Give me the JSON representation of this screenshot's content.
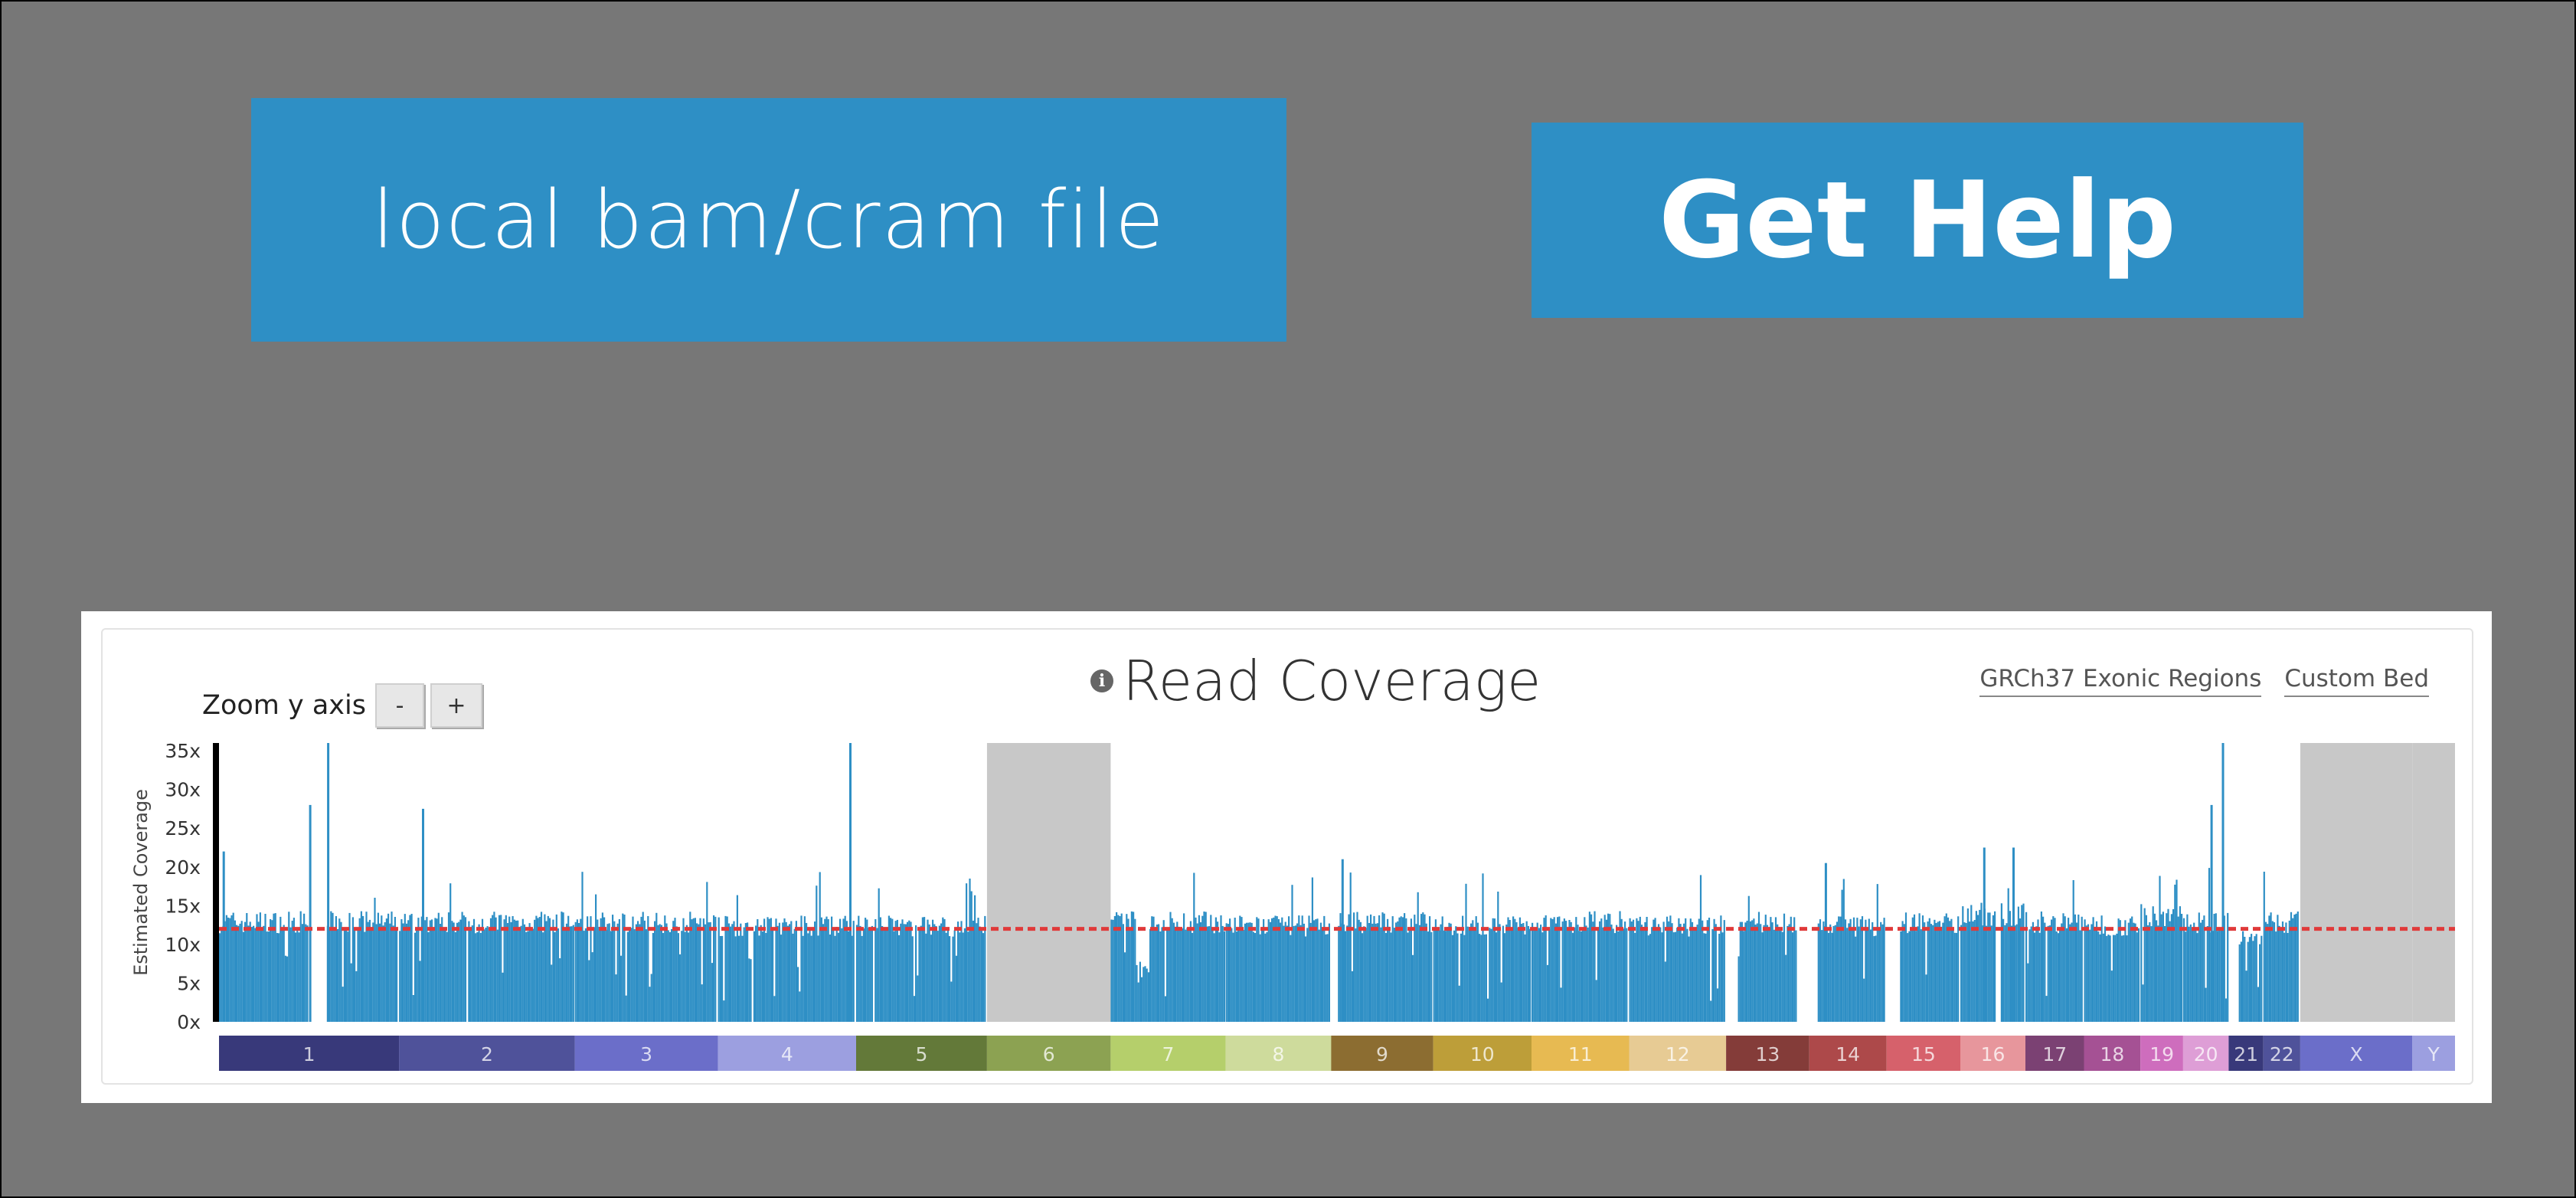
{
  "buttons": {
    "local_file": "local bam/cram file",
    "get_help": "Get Help"
  },
  "coverage": {
    "title": "Read Coverage",
    "info_icon": "info-icon",
    "zoom_label": "Zoom y axis",
    "zoom_minus": "-",
    "zoom_plus": "+",
    "link_exonic": "GRCh37 Exonic Regions",
    "link_custom": "Custom Bed"
  },
  "colors": {
    "button_bg": "#2e8fc5",
    "bar": "#2e8fc5",
    "median_line": "#e03a3a",
    "excluded": "#c8c8c8"
  },
  "chart_data": {
    "type": "bar",
    "ylabel": "Estimated Coverage",
    "yticks": [
      "0x",
      "5x",
      "10x",
      "15x",
      "20x",
      "25x",
      "30x",
      "35x"
    ],
    "ylim": [
      0,
      36
    ],
    "median_coverage": 12,
    "chromosomes": [
      {
        "name": "1",
        "len": 249,
        "color": "#38397a",
        "baseline": 13,
        "spikes": [
          [
            0.02,
            22
          ],
          [
            0.5,
            28
          ],
          [
            0.6,
            36
          ]
        ],
        "gaps": [
          [
            0.5,
            0.6
          ]
        ]
      },
      {
        "name": "2",
        "len": 243,
        "color": "#4f529a",
        "baseline": 13,
        "spikes": [
          [
            0.13,
            27.5
          ]
        ],
        "gaps": [
          [
            0.38,
            0.39
          ]
        ]
      },
      {
        "name": "3",
        "len": 198,
        "color": "#6b6ec9",
        "baseline": 13,
        "spikes": [],
        "gaps": [
          [
            0.81,
            0.82
          ]
        ]
      },
      {
        "name": "4",
        "len": 191,
        "color": "#9c9fe0",
        "baseline": 12.5,
        "spikes": [
          [
            0.95,
            36
          ]
        ],
        "gaps": [
          [
            0.24,
            0.25
          ]
        ]
      },
      {
        "name": "5",
        "len": 181,
        "color": "#637939",
        "baseline": 12.5,
        "spikes": [],
        "gaps": [
          [
            0.12,
            0.13
          ]
        ]
      },
      {
        "name": "6",
        "len": 171,
        "color": "#8ca252",
        "baseline": 0,
        "excluded": true,
        "spikes": [],
        "gaps": []
      },
      {
        "name": "7",
        "len": 159,
        "color": "#b5cf6b",
        "baseline": 13,
        "spikes": [],
        "gaps": [],
        "dips": [
          [
            0.22,
            0.33,
            7
          ]
        ]
      },
      {
        "name": "8",
        "len": 146,
        "color": "#cedb9c",
        "baseline": 12.5,
        "spikes": [],
        "gaps": []
      },
      {
        "name": "9",
        "len": 141,
        "color": "#8c6d31",
        "baseline": 13,
        "spikes": [
          [
            0.1,
            21
          ]
        ],
        "gaps": [
          [
            0.0,
            0.06
          ]
        ]
      },
      {
        "name": "10",
        "len": 136,
        "color": "#bd9e39",
        "baseline": 12.5,
        "spikes": [],
        "gaps": []
      },
      {
        "name": "11",
        "len": 135,
        "color": "#e7ba52",
        "baseline": 13,
        "spikes": [],
        "gaps": []
      },
      {
        "name": "12",
        "len": 134,
        "color": "#e7cb94",
        "baseline": 12.5,
        "spikes": [],
        "gaps": []
      },
      {
        "name": "13",
        "len": 115,
        "color": "#843c39",
        "baseline": 13,
        "spikes": [],
        "gaps": [
          [
            0.0,
            0.14
          ],
          [
            0.85,
            1.0
          ]
        ]
      },
      {
        "name": "14",
        "len": 107,
        "color": "#ad494a",
        "baseline": 12.5,
        "spikes": [
          [
            0.2,
            20.5
          ]
        ],
        "gaps": [
          [
            0.0,
            0.1
          ]
        ]
      },
      {
        "name": "15",
        "len": 102,
        "color": "#d6616b",
        "baseline": 13,
        "spikes": [],
        "gaps": [
          [
            0.0,
            0.17
          ]
        ]
      },
      {
        "name": "16",
        "len": 90,
        "color": "#e7969c",
        "baseline": 14,
        "spikes": [
          [
            0.35,
            22.5
          ],
          [
            0.8,
            22.5
          ]
        ],
        "gaps": [
          [
            0.55,
            0.62
          ]
        ]
      },
      {
        "name": "17",
        "len": 81,
        "color": "#7b4173",
        "baseline": 13,
        "spikes": [],
        "gaps": []
      },
      {
        "name": "18",
        "len": 78,
        "color": "#a55194",
        "baseline": 12.5,
        "spikes": [],
        "gaps": []
      },
      {
        "name": "19",
        "len": 59,
        "color": "#ce6dbd",
        "baseline": 14,
        "spikes": [],
        "gaps": []
      },
      {
        "name": "20",
        "len": 63,
        "color": "#de9ed6",
        "baseline": 13,
        "spikes": [
          [
            0.6,
            28
          ],
          [
            0.85,
            36
          ]
        ],
        "gaps": []
      },
      {
        "name": "21",
        "len": 48,
        "color": "#38397a",
        "baseline": 11,
        "spikes": [],
        "gaps": [
          [
            0.0,
            0.3
          ]
        ]
      },
      {
        "name": "22",
        "len": 51,
        "color": "#4f529a",
        "baseline": 13,
        "spikes": [],
        "gaps": []
      },
      {
        "name": "X",
        "len": 155,
        "color": "#6b6ec9",
        "baseline": 0,
        "excluded": true,
        "spikes": [],
        "gaps": []
      },
      {
        "name": "Y",
        "len": 59,
        "color": "#9c9fe0",
        "baseline": 0,
        "excluded": true,
        "spikes": [],
        "gaps": []
      }
    ]
  }
}
